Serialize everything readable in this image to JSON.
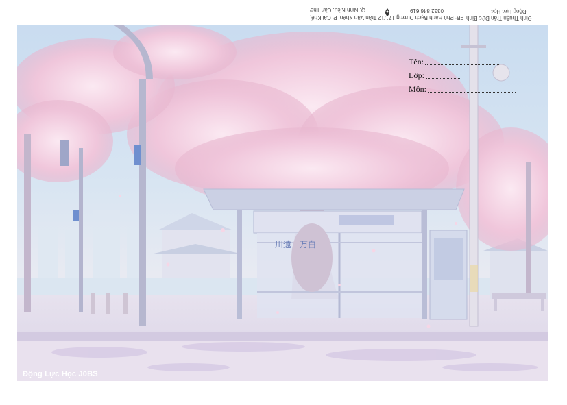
{
  "header": {
    "line1": "Đinh Thuận Trần Đức Bình",
    "line2": "Động Lực Học",
    "line3": "FB: Phú Hành Bạch Dương  171/12 Trần Văn Khéo, P. Cái Khế,",
    "line4": "Q. Ninh Kiều, Cần Thơ",
    "line5": "0332 846 619"
  },
  "form": {
    "name_label": "Tên:",
    "class_label": "Lớp:",
    "subject_label": "Môn:"
  },
  "brand": "Động Lực Học J0BS",
  "sign": "川遠 - 万白",
  "colors": {
    "sky": "#c9dcf0",
    "blossom": "#f3cfe0",
    "shelter": "#d7d8ea",
    "road": "#e6e0ec"
  }
}
